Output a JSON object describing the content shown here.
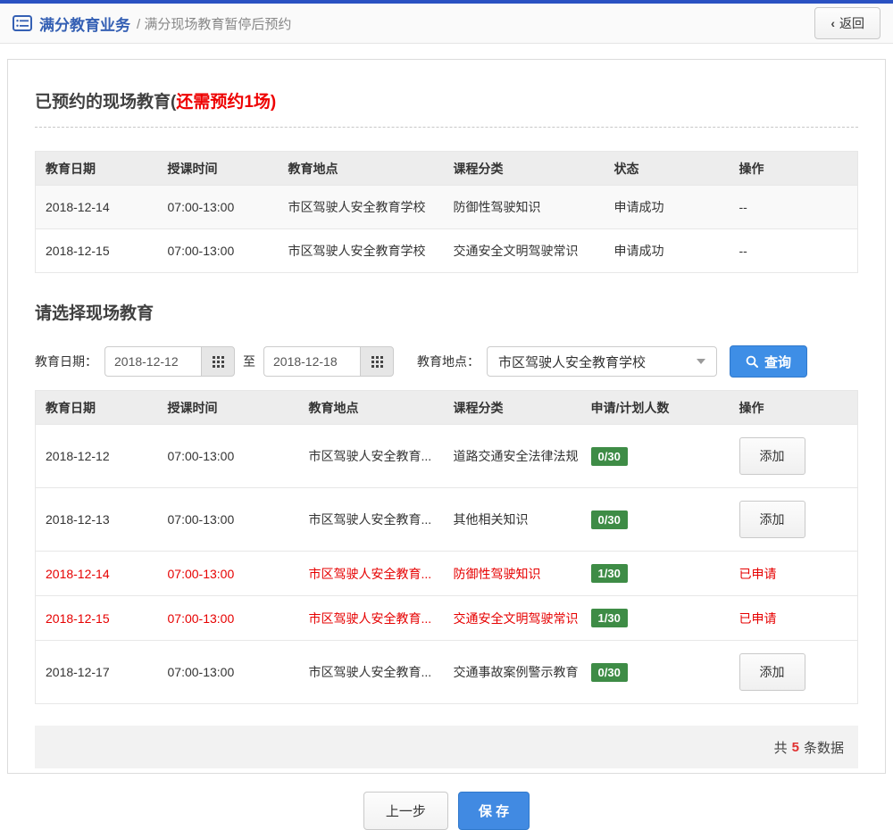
{
  "header": {
    "breadcrumb_root": "满分教育业务",
    "breadcrumb_current": "/ 满分现场教育暂停后预约",
    "back_chevron": "‹",
    "back_label": "返回"
  },
  "booked_section": {
    "title": "已预约的现场教育(",
    "title_highlight": "还需预约1场)",
    "table": {
      "headers": [
        "教育日期",
        "授课时间",
        "教育地点",
        "课程分类",
        "状态",
        "操作"
      ],
      "rows": [
        {
          "date": "2018-12-14",
          "time": "07:00-13:00",
          "place": "市区驾驶人安全教育学校",
          "course": "防御性驾驶知识",
          "status": "申请成功",
          "action": "--"
        },
        {
          "date": "2018-12-15",
          "time": "07:00-13:00",
          "place": "市区驾驶人安全教育学校",
          "course": "交通安全文明驾驶常识",
          "status": "申请成功",
          "action": "--"
        }
      ]
    }
  },
  "select_section": {
    "title": "请选择现场教育",
    "filter": {
      "date_label": "教育日期：",
      "date_from": "2018-12-12",
      "to_label": "至",
      "date_to": "2018-12-18",
      "place_label": "教育地点：",
      "place_value": "市区驾驶人安全教育学校",
      "search_label": "查询"
    },
    "table": {
      "headers": [
        "教育日期",
        "授课时间",
        "教育地点",
        "课程分类",
        "申请/计划人数",
        "操作"
      ],
      "rows": [
        {
          "date": "2018-12-12",
          "time": "07:00-13:00",
          "place": "市区驾驶人安全教育...",
          "course": "道路交通安全法律法规",
          "count": "0/30",
          "action": "添加",
          "applied": false
        },
        {
          "date": "2018-12-13",
          "time": "07:00-13:00",
          "place": "市区驾驶人安全教育...",
          "course": "其他相关知识",
          "count": "0/30",
          "action": "添加",
          "applied": false
        },
        {
          "date": "2018-12-14",
          "time": "07:00-13:00",
          "place": "市区驾驶人安全教育...",
          "course": "防御性驾驶知识",
          "count": "1/30",
          "action": "已申请",
          "applied": true
        },
        {
          "date": "2018-12-15",
          "time": "07:00-13:00",
          "place": "市区驾驶人安全教育...",
          "course": "交通安全文明驾驶常识",
          "count": "1/30",
          "action": "已申请",
          "applied": true
        },
        {
          "date": "2018-12-17",
          "time": "07:00-13:00",
          "place": "市区驾驶人安全教育...",
          "course": "交通事故案例警示教育",
          "count": "0/30",
          "action": "添加",
          "applied": false
        }
      ]
    },
    "footer": {
      "total_prefix": "共",
      "total_count": "5",
      "total_suffix": "条数据"
    }
  },
  "actions": {
    "prev_label": "上一步",
    "save_label": "保 存"
  },
  "icons": {
    "breadcrumb": "list-icon",
    "back": "chevron-left-icon",
    "date_picker": "calendar-grid-icon",
    "select": "chevron-down-icon",
    "search": "magnifier-icon"
  },
  "colors": {
    "top_bar": "#2a51c2",
    "breadcrumb_link": "#3560b4",
    "accent_blue": "#3e8ee6",
    "alert_red": "#ee0000",
    "applied_red": "#e60000",
    "badge_green": "#3e8c46",
    "table_header_bg": "#ededed",
    "footer_bg": "#f2f2f2"
  }
}
